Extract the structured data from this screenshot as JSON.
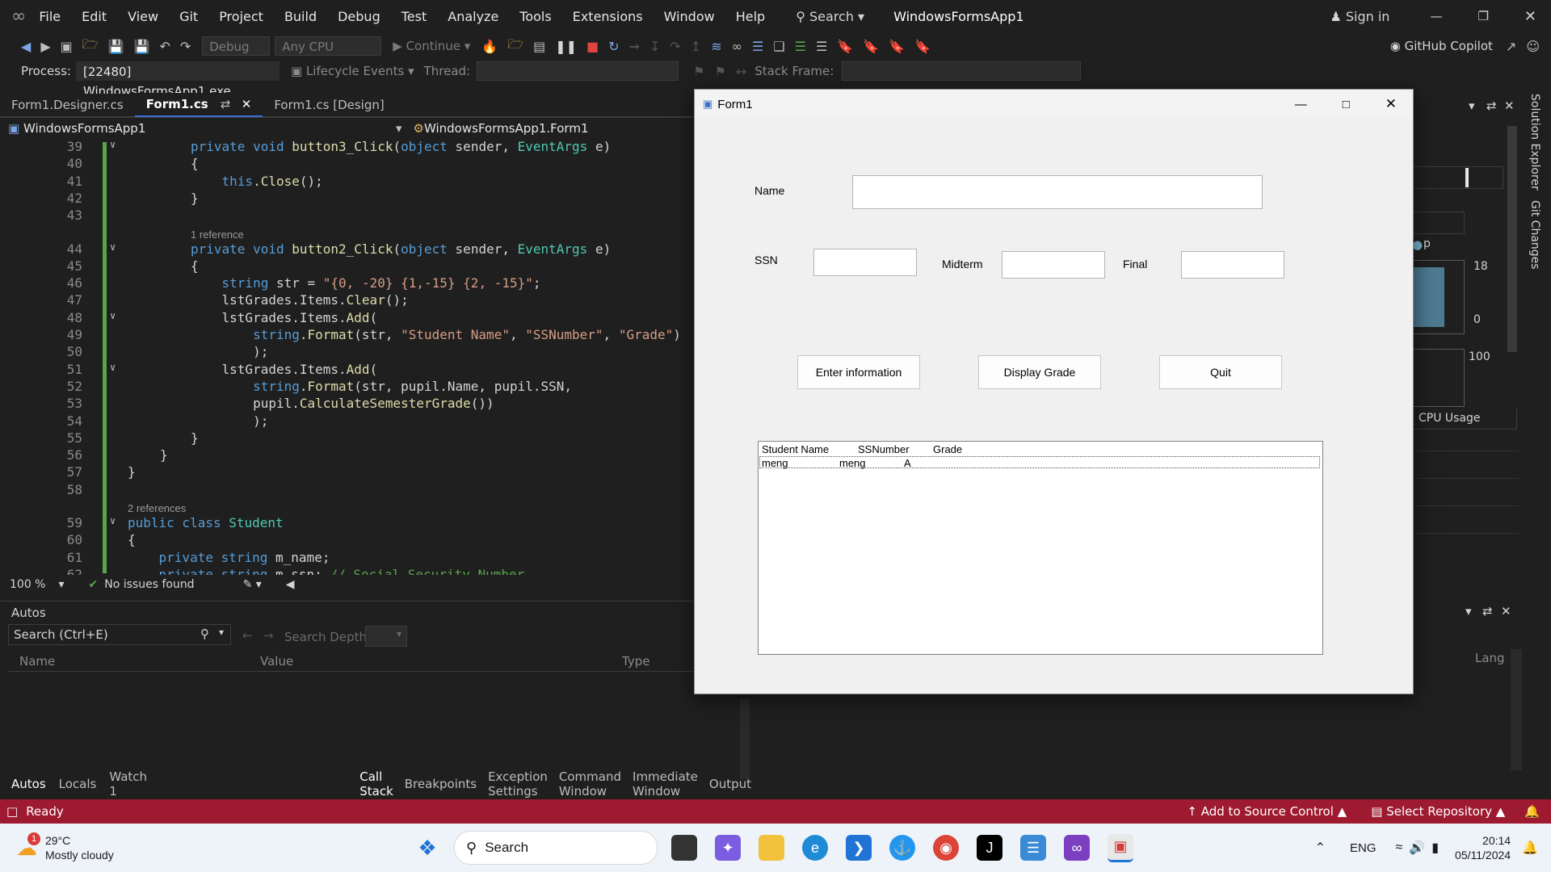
{
  "menubar": {
    "items": [
      "File",
      "Edit",
      "View",
      "Git",
      "Project",
      "Build",
      "Debug",
      "Test",
      "Analyze",
      "Tools",
      "Extensions",
      "Window",
      "Help"
    ],
    "search_label": "Search",
    "solution_name": "WindowsFormsApp1",
    "signin": "Sign in"
  },
  "toolbar": {
    "config": "Debug",
    "platform": "Any CPU",
    "continue": "Continue",
    "copilot": "GitHub Copilot"
  },
  "procbar": {
    "process_label": "Process:",
    "process_value": "[22480] WindowsFormsApp1.exe",
    "lifecycle": "Lifecycle Events",
    "thread_label": "Thread:",
    "stackframe_label": "Stack Frame:"
  },
  "editor": {
    "tabs": [
      {
        "label": "Form1.Designer.cs"
      },
      {
        "label": "Form1.cs"
      },
      {
        "label": "Form1.cs [Design]"
      }
    ],
    "nav_project": "WindowsFormsApp1",
    "nav_class": "WindowsFormsApp1.Form1",
    "zoom": "100 %",
    "issues": "No issues found",
    "refs": {
      "one": "1 reference",
      "two": "2 references"
    },
    "lines": [
      "39",
      "40",
      "41",
      "42",
      "43",
      "44",
      "45",
      "46",
      "47",
      "48",
      "49",
      "50",
      "51",
      "52",
      "53",
      "54",
      "55",
      "56",
      "57",
      "58",
      "59",
      "60",
      "61",
      "62"
    ]
  },
  "autos": {
    "title": "Autos",
    "search_placeholder": "Search (Ctrl+E)",
    "search_depth": "Search Depth:",
    "col_name": "Name",
    "col_value": "Value",
    "col_type": "Type",
    "col_lang": "Lang",
    "bottom_tabs": [
      "Autos",
      "Locals",
      "Watch 1"
    ],
    "right_tabs": [
      "Call Stack",
      "Breakpoints",
      "Exception Settings",
      "Command Window",
      "Immediate Window",
      "Output"
    ]
  },
  "diag": {
    "cpu_usage": "CPU Usage",
    "val_18": "18",
    "val_0": "0",
    "val_100": "100",
    "p": "p",
    "solution_explorer": "Solution Explorer",
    "git_changes": "Git Changes"
  },
  "statusbar": {
    "ready": "Ready",
    "source_control": "Add to Source Control",
    "select_repo": "Select Repository"
  },
  "form": {
    "title": "Form1",
    "name_label": "Name",
    "ssn_label": "SSN",
    "midterm_label": "Midterm",
    "final_label": "Final",
    "btn_enter": "Enter information",
    "btn_display": "Display Grade",
    "btn_quit": "Quit",
    "list_header": [
      "Student Name",
      "SSNumber",
      "Grade"
    ],
    "list_row": [
      "meng",
      "meng",
      "A"
    ]
  },
  "taskbar": {
    "weather_temp": "29°C",
    "weather_desc": "Mostly cloudy",
    "weather_badge": "1",
    "search": "Search",
    "lang": "ENG",
    "time": "20:14",
    "date": "05/11/2024"
  }
}
